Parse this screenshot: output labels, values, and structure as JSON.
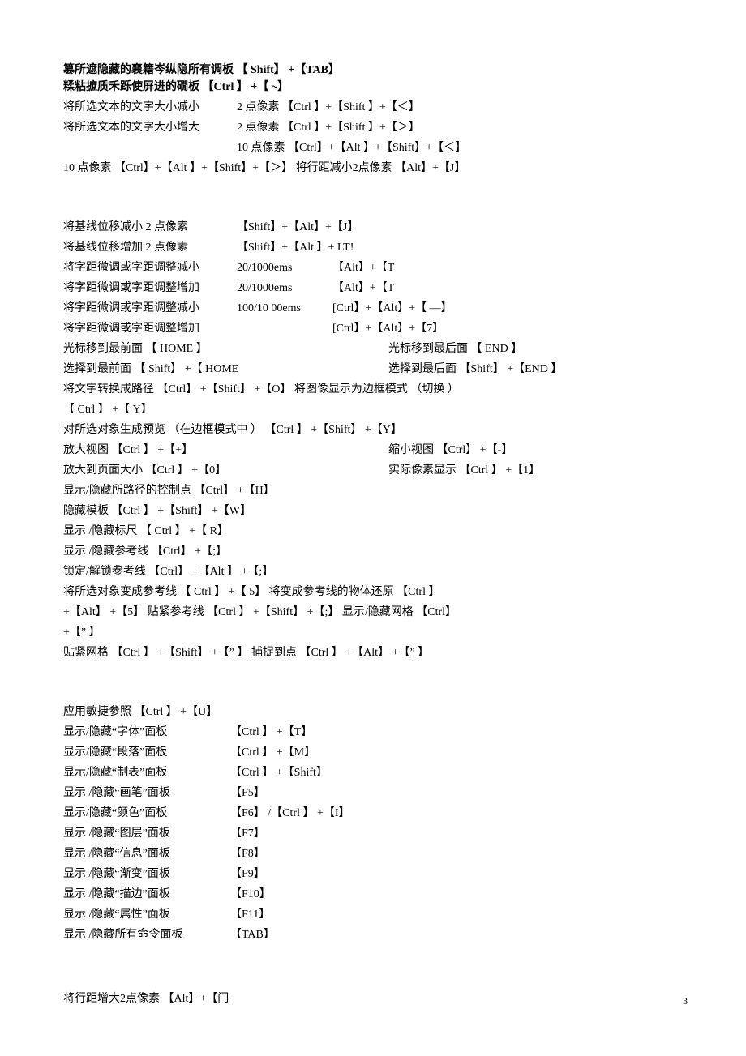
{
  "lines": {
    "l1": "篡所遮隐藏的襄籍岑纵隐所有调板  【 Shift】 +【TAB】",
    "l2": "糅粘摭质禾跞使屏进的礀板  【Ctrl 】 +【 ~】",
    "l3a": "将所选文本的文字大小减小",
    "l3b": "2 点像素 【Ctrl 】+【Shift 】+【＜】",
    "l4a": "将所选文本的文字大小增大",
    "l4b": "2 点像素 【Ctrl 】+【Shift 】+【＞】",
    "l4c": "10 点像素 【Ctrl】+【Alt 】+【Shift】+【＜】",
    "l5": " 10 点像素 【Ctrl】+【Alt 】+【Shift】+【＞】 将行距减小2点像素 【Alt】+【J】",
    "l6a": "将基线位移减小 2 点像素",
    "l6b": "【Shift】+【Alt】+【J】",
    "l7a": "将基线位移增加 2 点像素",
    "l7b": "【Shift】+【Alt 】+ LT!",
    "l8a": "将字距微调或字距调整减小",
    "l8b": "20/1000ems",
    "l8c": "【Alt】+【T",
    "l9a": "将字距微调或字距调整增加",
    "l9b": "20/1000ems",
    "l9c": "【Alt】+【T",
    "l10a": "将字距微调或字距调整减小",
    "l10b": "100/10 00ems",
    "l10c": "[Ctrl】+【Alt】+【 ―】",
    "l11a": "将字距微调或字距调整增加",
    "l11c": "[Ctrl】+【Alt】+【7】",
    "l12a": "光标移到最前面   【 HOME 】",
    "l12b": "光标移到最后面 【   END 】",
    "l13a": "选择到最前面 【 Shift】 +【 HOME",
    "l13b": "选择到最后面 【Shift】 +【END 】",
    "l14": "将文字转换成路径 【Ctrl】 +【Shift】 +【O】 将图像显示为边框模式     （切换 ）",
    "l15": "【 Ctrl 】 +【 Y】",
    "l16": "对所选对象生成预览   （在边框模式中 ） 【Ctrl 】 +【Shift】 +【Y】",
    "l17a": "放大视图 【Ctrl 】 +【+】",
    "l17b": "缩小视图 【Ctrl】 +【-】",
    "l18a": "放大到页面大小 【Ctrl 】 +【0】",
    "l18b": "实际像素显示 【Ctrl 】 +【1】",
    "l19": "显示/隐藏所路径的控制点     【Ctrl】 +【H】",
    "l20": "隐藏模板 【Ctrl 】 +【Shift】 +【W】",
    "l21": "显示 /隐藏标尺   【 Ctrl 】 +【 R】",
    "l22": "显示 /隐藏参考线    【Ctrl】 +【;】",
    "l23": "锁定/解锁参考线     【Ctrl】 +【Alt 】 +【;】",
    "l24": "将所选对象变成参考线 【 Ctrl 】 +【 5】 将变成参考线的物体还原 【Ctrl 】",
    "l25": "+【Alt】 +【5】 贴紧参考线 【Ctrl 】 +【Shift】 +【;】 显示/隐藏网格    【Ctrl】",
    "l26": "+【” 】",
    "l27": "贴紧网格 【Ctrl 】 +【Shift】 +【” 】 捕捉到点 【Ctrl 】 +【Alt】 +【” 】",
    "p0": "应用敏捷参照 【Ctrl 】 +【U】",
    "p1a": "显示/隐藏“字体”面板",
    "p1b": "【Ctrl 】 +【T】",
    "p2a": "显示/隐藏“段落”面板",
    "p2b": "【Ctrl 】 +【M】",
    "p3a": "显示/隐藏“制表”面板",
    "p3b": "【Ctrl 】 +【Shift】",
    "p4a": "显示 /隐藏“画笔”面板",
    "p4b": "【F5】",
    "p5a": "显示/隐藏“颜色”面板",
    "p5b": "【F6】 /【Ctrl 】 +【I】",
    "p6a": "显示 /隐藏“图层”面板",
    "p6b": "【F7】",
    "p7a": "显示 /隐藏“信息”面板",
    "p7b": "【F8】",
    "p8a": "显示 /隐藏“渐变”面板",
    "p8b": "【F9】",
    "p9a": "显示 /隐藏“描边”面板",
    "p9b": "【F10】",
    "p10a": "显示 /隐藏“属性”面板",
    "p10b": "【F11】",
    "p11a": "显示 /隐藏所有命令面板",
    "p11b": "【TAB】",
    "bot": "将行距增大2点像素 【Alt】+【门",
    "idx": "3"
  }
}
